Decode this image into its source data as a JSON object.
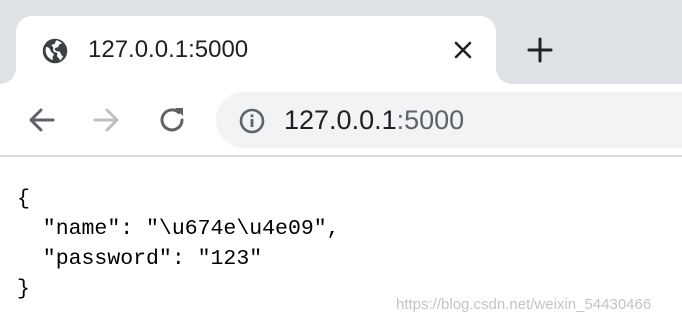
{
  "tab": {
    "title": "127.0.0.1:5000",
    "favicon": "globe-icon",
    "close_icon": "close-icon"
  },
  "new_tab_icon": "plus-icon",
  "toolbar": {
    "back_icon": "back-arrow-icon",
    "forward_icon": "forward-arrow-icon",
    "reload_icon": "reload-icon"
  },
  "address_bar": {
    "info_icon": "info-icon",
    "host": "127.0.0.1",
    "port": ":5000"
  },
  "page": {
    "json_text": "{\n  \"name\": \"\\u674e\\u4e09\",\n  \"password\": \"123\"\n}"
  },
  "watermark": "https://blog.csdn.net/weixin_54430466",
  "colors": {
    "tabstrip": "#dee1e6",
    "omnibox": "#f1f3f4",
    "icon": "#5f6368",
    "disabled_icon": "#bdc1c6"
  }
}
